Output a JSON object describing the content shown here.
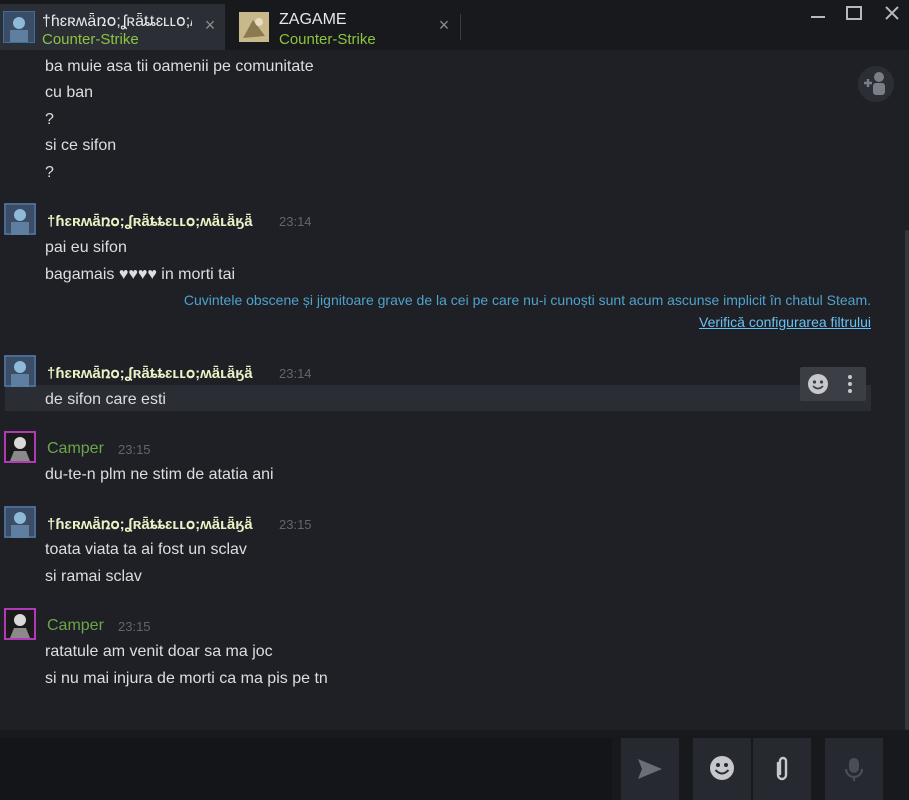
{
  "tabs": [
    {
      "name": "†ɦɛʀʍǟռօ;ʆʀǟȶȶɛʟʟօ;ʍǟʟǟӄǟ",
      "game": "Counter-Strike",
      "close": "×"
    },
    {
      "name": "ZAGAME",
      "game": "Counter-Strike",
      "close": "×"
    }
  ],
  "window": {
    "minimize": "—",
    "maximize": "☐",
    "close": "✕"
  },
  "messages": {
    "top_lines": [
      "ba muie asa tii oamenii pe comunitate",
      "cu ban",
      "?",
      "si ce sifon",
      "?"
    ],
    "group1": {
      "sender": "†ɦɛʀʍǟռօ;ʆʀǟȶȶɛʟʟօ;ʍǟʟǟӄǟ",
      "time": "23:14",
      "lines": [
        "pai eu sifon",
        "bagamais ♥♥♥♥ in morti tai"
      ],
      "notice": "Cuvintele obscene și jignitoare grave de la cei pe care nu-i cunoști sunt acum ascunse implicit în chatul Steam.",
      "notice_link": "Verifică configurarea filtrului"
    },
    "group2": {
      "sender": "†ɦɛʀʍǟռօ;ʆʀǟȶȶɛʟʟօ;ʍǟʟǟӄǟ",
      "time": "23:14",
      "lines": [
        "de sifon care esti"
      ]
    },
    "group3": {
      "sender": "Camper",
      "time": "23:15",
      "lines": [
        "du-te-n plm ne stim de atatia ani"
      ]
    },
    "group4": {
      "sender": "†ɦɛʀʍǟռօ;ʆʀǟȶȶɛʟʟօ;ʍǟʟǟӄǟ",
      "time": "23:15",
      "lines": [
        "toata viata ta ai fost un sclav",
        "si ramai sclav"
      ]
    },
    "group5": {
      "sender": "Camper",
      "time": "23:15",
      "lines": [
        "ratatule am venit doar sa ma joc",
        "si nu mai injura de morti ca ma pis pe tn"
      ]
    }
  },
  "icons": {
    "add_friend": "add-friend-icon",
    "send": "send-icon",
    "emoji": "emoji-icon",
    "attach": "paperclip-icon",
    "voice": "microphone-icon",
    "more": "more-vertical-icon"
  },
  "colors": {
    "background": "#1e2025",
    "game_green": "#8bc53f",
    "camper_green": "#6da64a",
    "notice_blue": "#4fa2cc",
    "link_blue": "#67c1f5"
  }
}
